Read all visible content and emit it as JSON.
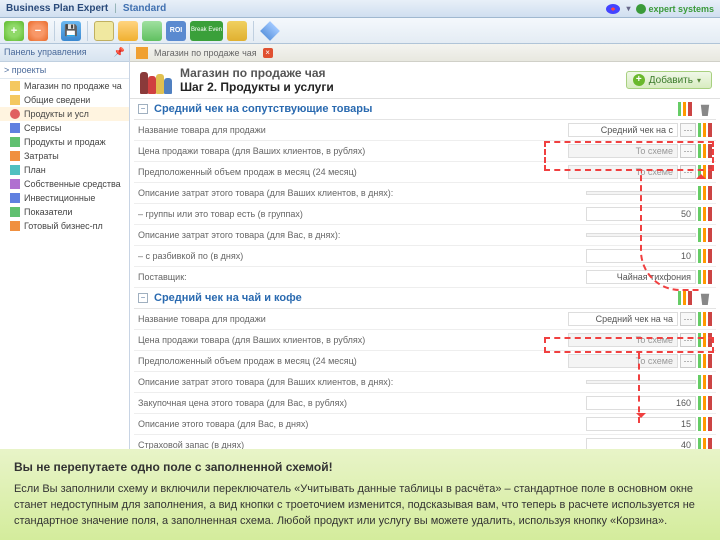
{
  "titlebar": {
    "app": "Business Plan Expert",
    "mode": "Standard",
    "logo": "expert systems"
  },
  "toolbar": {
    "roi": "ROI",
    "breakeven": "Break\nEven"
  },
  "sidebar": {
    "panel": "Панель управления",
    "projects": "> проекты",
    "root": "Магазин по продаже ча",
    "items": [
      {
        "label": "Общие сведени",
        "cls": "si-folder"
      },
      {
        "label": "Продукты и усл",
        "cls": "si-red"
      },
      {
        "label": "Сервисы",
        "cls": "si-blue"
      },
      {
        "label": "Продукты и продаж",
        "cls": "si-green"
      },
      {
        "label": "Затраты",
        "cls": "si-orange"
      },
      {
        "label": "План",
        "cls": "si-cyan"
      },
      {
        "label": "Собственные средства",
        "cls": "si-purple"
      },
      {
        "label": "Инвестиционные",
        "cls": "si-blue"
      },
      {
        "label": "Показатели",
        "cls": "si-green"
      },
      {
        "label": "Готовый бизнес-пл",
        "cls": "si-orange"
      }
    ]
  },
  "crumb": {
    "text": "Магазин по продаже чая"
  },
  "page": {
    "title": "Магазин по продаже чая",
    "step": "Шаг 2. Продукты и услуги",
    "add": "Добавить"
  },
  "sections": [
    {
      "title": "Средний чек на сопутствующие товары",
      "rows": [
        {
          "label": "Название товара для продажи",
          "value": "Средний чек на с",
          "type": "text",
          "dots": true
        },
        {
          "label": "Цена продажи товара (для Ваших клиентов, в рублях)",
          "value": "То схеме",
          "type": "gray",
          "dots": true
        },
        {
          "label": "Предположенный объем продаж в месяц (24 месяц)",
          "value": "То схеме",
          "type": "gray",
          "dots": true
        },
        {
          "label": "Описание затрат этого товара (для Ваших клиентов, в днях):",
          "value": "",
          "type": "gray"
        },
        {
          "label": "– группы или это товар есть (в группах)",
          "value": "50",
          "type": "num"
        },
        {
          "label": "Описание затрат этого товара (для Вас, в днях):",
          "value": "",
          "type": "gray"
        },
        {
          "label": "– с разбивкой по (в днях)",
          "value": "10",
          "type": "num"
        },
        {
          "label": "Поставщик:",
          "value": "Чайная тихфония",
          "type": "text"
        }
      ]
    },
    {
      "title": "Средний чек на чай и кофе",
      "rows": [
        {
          "label": "Название товара для продажи",
          "value": "Средний чек на ча",
          "type": "text",
          "dots": true
        },
        {
          "label": "Цена продажи товара (для Ваших клиентов, в рублях)",
          "value": "То схеме",
          "type": "gray",
          "dots": true
        },
        {
          "label": "Предположенный объем продаж в месяц (24 месяц)",
          "value": "То схеме",
          "type": "gray",
          "dots": true
        },
        {
          "label": "Описание затрат этого товара (для Ваших клиентов, в днях):",
          "value": "",
          "type": "gray"
        },
        {
          "label": "Закупочная цена этого товара (для Вас, в рублях)",
          "value": "160",
          "type": "num"
        },
        {
          "label": "Описание этого товара (для Вас, в днях)",
          "value": "15",
          "type": "num"
        },
        {
          "label": "Страховой запас (в днях)",
          "value": "40",
          "type": "num"
        }
      ]
    }
  ],
  "note": {
    "title": "Вы не перепутаете одно поле с заполненной схемой!",
    "body": "Если Вы заполнили схему и включили переключатель «Учитывать данные таблицы в расчёта» – стандартное поле в основном окне станет недоступным для заполнения, а вид кнопки с троеточием изменится, подсказывая вам, что теперь в расчете используется не стандартное значение поля, а заполненная схема. Любой продукт или услугу вы можете удалить, используя кнопку «Корзина»."
  }
}
